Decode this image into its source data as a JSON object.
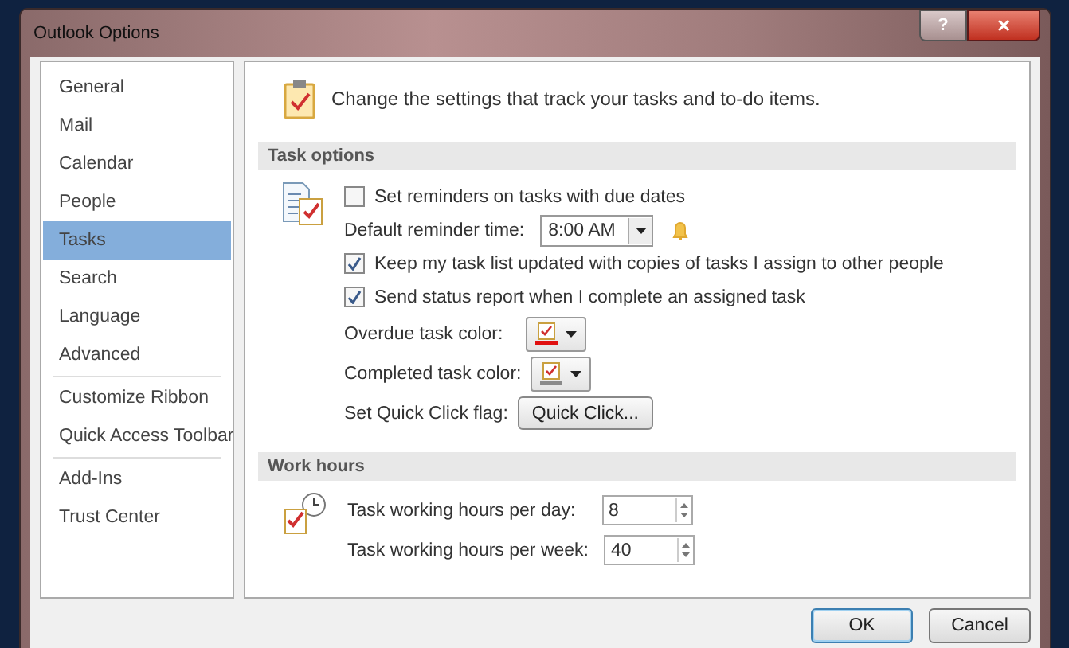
{
  "window": {
    "title": "Outlook Options",
    "help_button": "?",
    "close_button": "✕"
  },
  "sidebar": {
    "groups": [
      [
        {
          "label": "General",
          "selected": false
        },
        {
          "label": "Mail",
          "selected": false
        },
        {
          "label": "Calendar",
          "selected": false
        },
        {
          "label": "People",
          "selected": false
        },
        {
          "label": "Tasks",
          "selected": true
        },
        {
          "label": "Search",
          "selected": false
        },
        {
          "label": "Language",
          "selected": false
        },
        {
          "label": "Advanced",
          "selected": false
        }
      ],
      [
        {
          "label": "Customize Ribbon",
          "selected": false
        },
        {
          "label": "Quick Access Toolbar",
          "selected": false
        }
      ],
      [
        {
          "label": "Add-Ins",
          "selected": false
        },
        {
          "label": "Trust Center",
          "selected": false
        }
      ]
    ]
  },
  "header": "Change the settings that track your tasks and to-do items.",
  "sections": [
    {
      "title": "Task options",
      "rows": [
        {
          "kind": "checkbox",
          "label": "Set reminders on tasks with due dates",
          "checked": false
        },
        {
          "kind": "time",
          "label": "Default reminder time:",
          "value": "8:00 AM"
        },
        {
          "kind": "checkbox",
          "label": "Keep my task list updated with copies of tasks I assign to other people",
          "checked": true
        },
        {
          "kind": "checkbox",
          "label": "Send status report when I complete an assigned task",
          "checked": true
        },
        {
          "kind": "color",
          "label": "Overdue task color:",
          "color": "#e01010"
        },
        {
          "kind": "color",
          "label": "Completed task color:",
          "color": "#8a8a8a"
        },
        {
          "kind": "button",
          "label": "Set Quick Click flag:",
          "button": "Quick Click..."
        }
      ]
    },
    {
      "title": "Work hours",
      "rows": [
        {
          "kind": "spin",
          "label": "Task working hours per day:",
          "value": "8"
        },
        {
          "kind": "spin",
          "label": "Task working hours per week:",
          "value": "40"
        }
      ]
    }
  ],
  "buttons": [
    {
      "label": "OK",
      "default": true
    },
    {
      "label": "Cancel",
      "default": false
    }
  ]
}
